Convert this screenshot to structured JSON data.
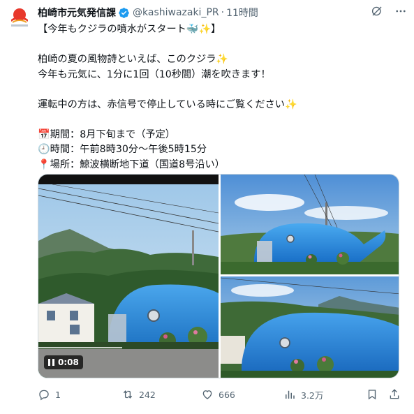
{
  "post": {
    "author_name": "柏崎市元気発信課",
    "handle": "@kashiwazaki_PR",
    "separator": "·",
    "time": "11時間",
    "lines": [
      "【今年もクジラの噴水がスタート🐳✨】",
      "",
      "柏崎の夏の風物詩といえば、このクジラ✨",
      "今年も元気に、1分に1回（10秒間）潮を吹きます！",
      "",
      "運転中の方は、赤信号で停止している時にご覧ください✨",
      "",
      "📅期間：8月下旬まで（予定）",
      "🕘時間：午前8時30分～午後5時15分",
      "📍場所：鯨波横断地下道（国道8号沿い）"
    ],
    "video_duration": "0:08"
  },
  "actions": {
    "replies": "1",
    "reposts": "242",
    "likes": "666",
    "views": "3.2万"
  },
  "icons": {
    "avatar": "kashiwazaki-logo-icon",
    "verified": "verified-badge-icon",
    "grok": "grok-icon",
    "more": "more-icon",
    "reply": "reply-icon",
    "repost": "repost-icon",
    "like": "like-icon",
    "views": "views-icon",
    "bookmark": "bookmark-icon",
    "share": "share-icon"
  },
  "colors": {
    "verified_blue": "#1d9bf0",
    "text_primary": "#0f1419",
    "text_secondary": "#536471",
    "whale_blue": "#2a8ad8"
  }
}
